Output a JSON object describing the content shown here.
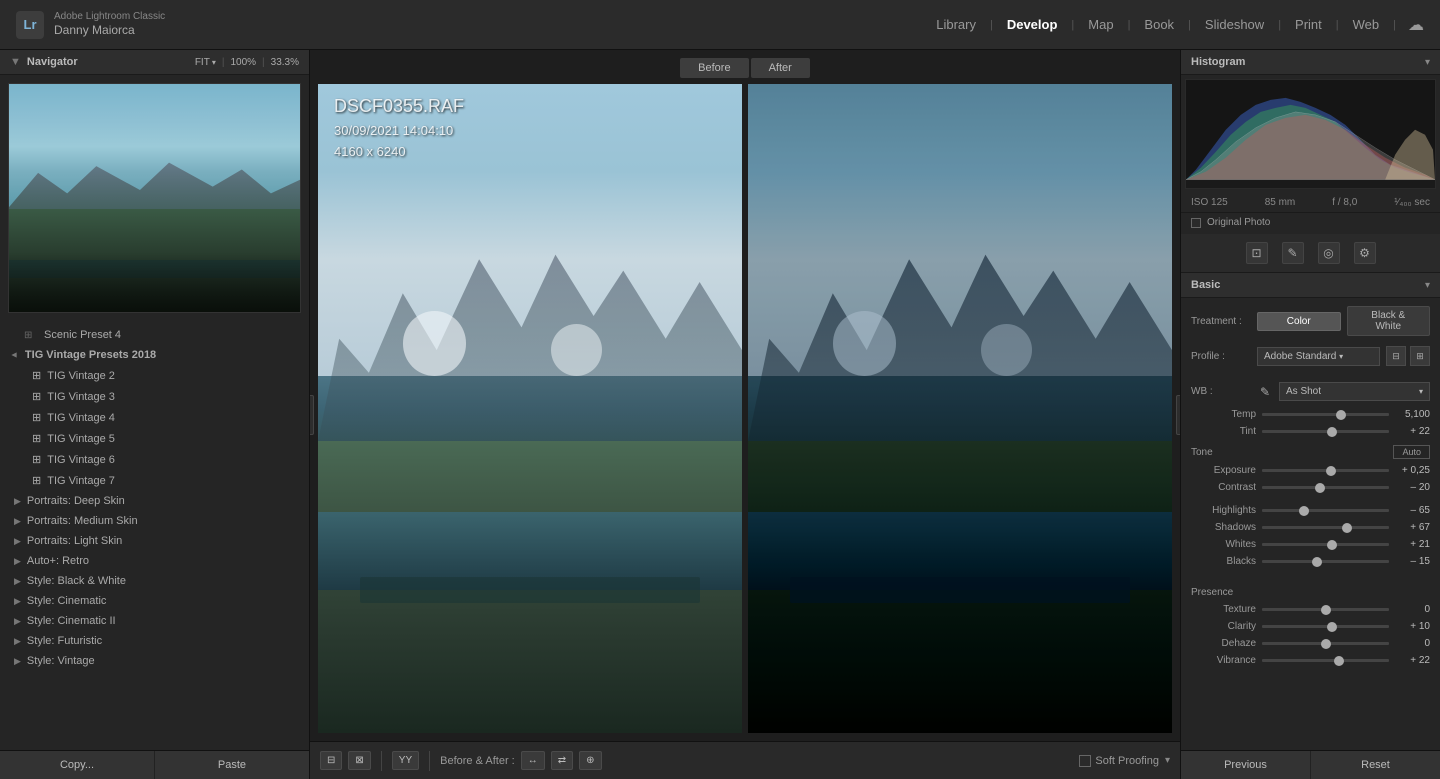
{
  "app": {
    "company": "Adobe Lightroom Classic",
    "user": "Danny Maiorca",
    "logo_text": "Lr"
  },
  "nav": {
    "links": [
      "Library",
      "Develop",
      "Map",
      "Book",
      "Slideshow",
      "Print",
      "Web"
    ],
    "active": "Develop"
  },
  "left_panel": {
    "navigator_title": "Navigator",
    "fit_label": "FIT ▾",
    "zoom1": "100%",
    "zoom2": "33.3%"
  },
  "presets": {
    "scenic_preset": "Scenic Preset 4",
    "group_name": "TIG Vintage Presets 2018",
    "items": [
      {
        "name": "TIG Vintage 2",
        "selected": false
      },
      {
        "name": "TIG Vintage 3",
        "selected": false
      },
      {
        "name": "TIG Vintage 4",
        "selected": false
      },
      {
        "name": "TIG Vintage 5",
        "selected": true
      },
      {
        "name": "TIG Vintage 6",
        "selected": false
      },
      {
        "name": "TIG Vintage 7",
        "selected": false
      }
    ],
    "categories": [
      "Portraits: Deep Skin",
      "Portraits: Medium Skin",
      "Portraits: Light Skin",
      "Auto+: Retro",
      "Style: Black & White",
      "Style: Cinematic",
      "Style: Cinematic II",
      "Style: Futuristic",
      "Style: Vintage"
    ]
  },
  "bottom_left": {
    "copy_label": "Copy...",
    "paste_label": "Paste"
  },
  "image_view": {
    "before_label": "Before",
    "after_label": "After",
    "filename": "DSCF0355.RAF",
    "date": "30/09/2021 14:04:10",
    "dimensions": "4160 x 6240"
  },
  "toolbar": {
    "before_after_label": "Before & After :",
    "soft_proofing_label": "Soft Proofing"
  },
  "histogram": {
    "title": "Histogram",
    "iso": "ISO 125",
    "focal": "85 mm",
    "aperture": "f / 8,0",
    "shutter": "¹⁄₄₀₀ sec",
    "original_photo": "Original Photo"
  },
  "basic": {
    "section_title": "Basic",
    "treatment_label": "Treatment :",
    "color_label": "Color",
    "bw_label": "Black & White",
    "profile_label": "Profile :",
    "profile_value": "Adobe Standard",
    "wb_label": "WB :",
    "wb_eyedropper": "✎",
    "wb_value": "As Shot",
    "temp_label": "Temp",
    "temp_value": "5,100",
    "tint_label": "Tint",
    "tint_value": "+ 22",
    "tone_label": "Tone",
    "auto_label": "Auto",
    "exposure_label": "Exposure",
    "exposure_value": "+ 0,25",
    "contrast_label": "Contrast",
    "contrast_value": "– 20",
    "highlights_label": "Highlights",
    "highlights_value": "– 65",
    "shadows_label": "Shadows",
    "shadows_value": "+ 67",
    "whites_label": "Whites",
    "whites_value": "+ 21",
    "blacks_label": "Blacks",
    "blacks_value": "– 15",
    "presence_label": "Presence",
    "texture_label": "Texture",
    "texture_value": "0",
    "clarity_label": "Clarity",
    "clarity_value": "+ 10",
    "dehaze_label": "Dehaze",
    "dehaze_value": "0",
    "vibrance_label": "Vibrance",
    "vibrance_value": "+ 22"
  },
  "bottom_right": {
    "previous_label": "Previous",
    "reset_label": "Reset"
  }
}
